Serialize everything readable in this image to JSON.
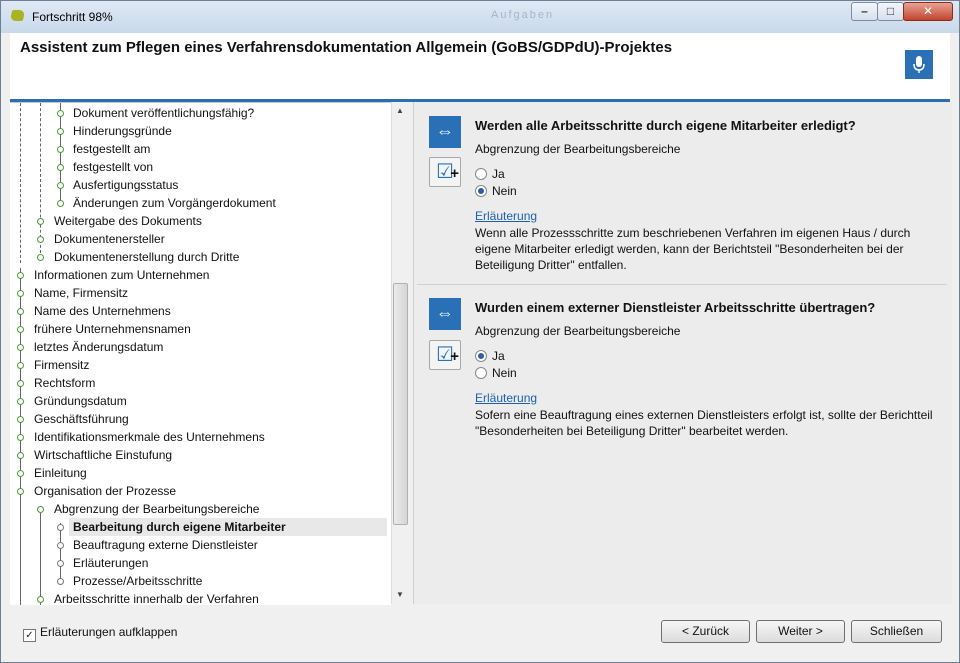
{
  "window": {
    "title": "Fortschritt 98%",
    "background_text": "Aufgaben",
    "controls": {
      "minimize": "–",
      "maximize": "□",
      "close": "✕"
    }
  },
  "header": {
    "title": "Assistent zum Pflegen eines Verfahrensdokumentation Allgemein (GoBS/GDPdU)-Projektes",
    "mic_icon": "microphone-icon"
  },
  "tree": {
    "items": [
      {
        "label": "Dokument veröffentlichungsfähig?",
        "level": 3
      },
      {
        "label": "Hinderungsgründe",
        "level": 3
      },
      {
        "label": "festgestellt am",
        "level": 3
      },
      {
        "label": "festgestellt von",
        "level": 3
      },
      {
        "label": "Ausfertigungsstatus",
        "level": 3
      },
      {
        "label": "Änderungen zum Vorgängerdokument",
        "level": 3
      },
      {
        "label": "Weitergabe des Dokuments",
        "level": 2
      },
      {
        "label": "Dokumentenersteller",
        "level": 2
      },
      {
        "label": "Dokumentenerstellung durch Dritte",
        "level": 2
      },
      {
        "label": "Informationen zum Unternehmen",
        "level": 1
      },
      {
        "label": "Name, Firmensitz",
        "level": 1
      },
      {
        "label": "Name des Unternehmens",
        "level": 1
      },
      {
        "label": "frühere Unternehmensnamen",
        "level": 1
      },
      {
        "label": "letztes Änderungsdatum",
        "level": 1
      },
      {
        "label": "Firmensitz",
        "level": 1
      },
      {
        "label": "Rechtsform",
        "level": 1
      },
      {
        "label": "Gründungsdatum",
        "level": 1
      },
      {
        "label": "Geschäftsführung",
        "level": 1
      },
      {
        "label": "Identifikationsmerkmale des Unternehmens",
        "level": 1
      },
      {
        "label": "Wirtschaftliche Einstufung",
        "level": 1
      },
      {
        "label": "Einleitung",
        "level": 1
      },
      {
        "label": "Organisation der Prozesse",
        "level": 1
      },
      {
        "label": "Abgrenzung der Bearbeitungsbereiche",
        "level": 2
      },
      {
        "label": "Bearbeitung durch eigene Mitarbeiter",
        "level": 3,
        "selected": true
      },
      {
        "label": "Beauftragung externe Dienstleister",
        "level": 3
      },
      {
        "label": "Erläuterungen",
        "level": 3
      },
      {
        "label": "Prozesse/Arbeitsschritte",
        "level": 3
      },
      {
        "label": "Arbeitsschritte innerhalb der Verfahren",
        "level": 2
      }
    ]
  },
  "questions": [
    {
      "question": "Werden alle Arbeitsschritte durch eigene Mitarbeiter erledigt?",
      "category": "Abgrenzung der Bearbeitungsbereiche",
      "options": [
        "Ja",
        "Nein"
      ],
      "selected": "Nein",
      "link": "Erläuterung",
      "description": "Wenn alle Prozessschritte zum beschriebenen Verfahren im eigenen Haus / durch eigene Mitarbeiter erledigt werden, kann der Berichtsteil \"Besonderheiten bei der Beteiligung Dritter\" entfallen."
    },
    {
      "question": "Wurden einem externer Dienstleister Arbeitsschritte übertragen?",
      "category": "Abgrenzung der Bearbeitungsbereiche",
      "options": [
        "Ja",
        "Nein"
      ],
      "selected": "Ja",
      "link": "Erläuterung",
      "description": "Sofern eine Beauftragung eines externen Dienstleisters erfolgt ist, sollte der Berichtteil \"Besonderheiten bei Beteiligung Dritter\" bearbeitet werden."
    }
  ],
  "footer": {
    "checkbox_label": "Erläuterungen aufklappen",
    "checkbox_checked": true,
    "back_label": "< Zurück",
    "next_label": "Weiter >",
    "close_label": "Schließen"
  },
  "colors": {
    "accent": "#2a70b6",
    "tree_dot": "#4b9a35",
    "link": "#1c5fb0"
  }
}
